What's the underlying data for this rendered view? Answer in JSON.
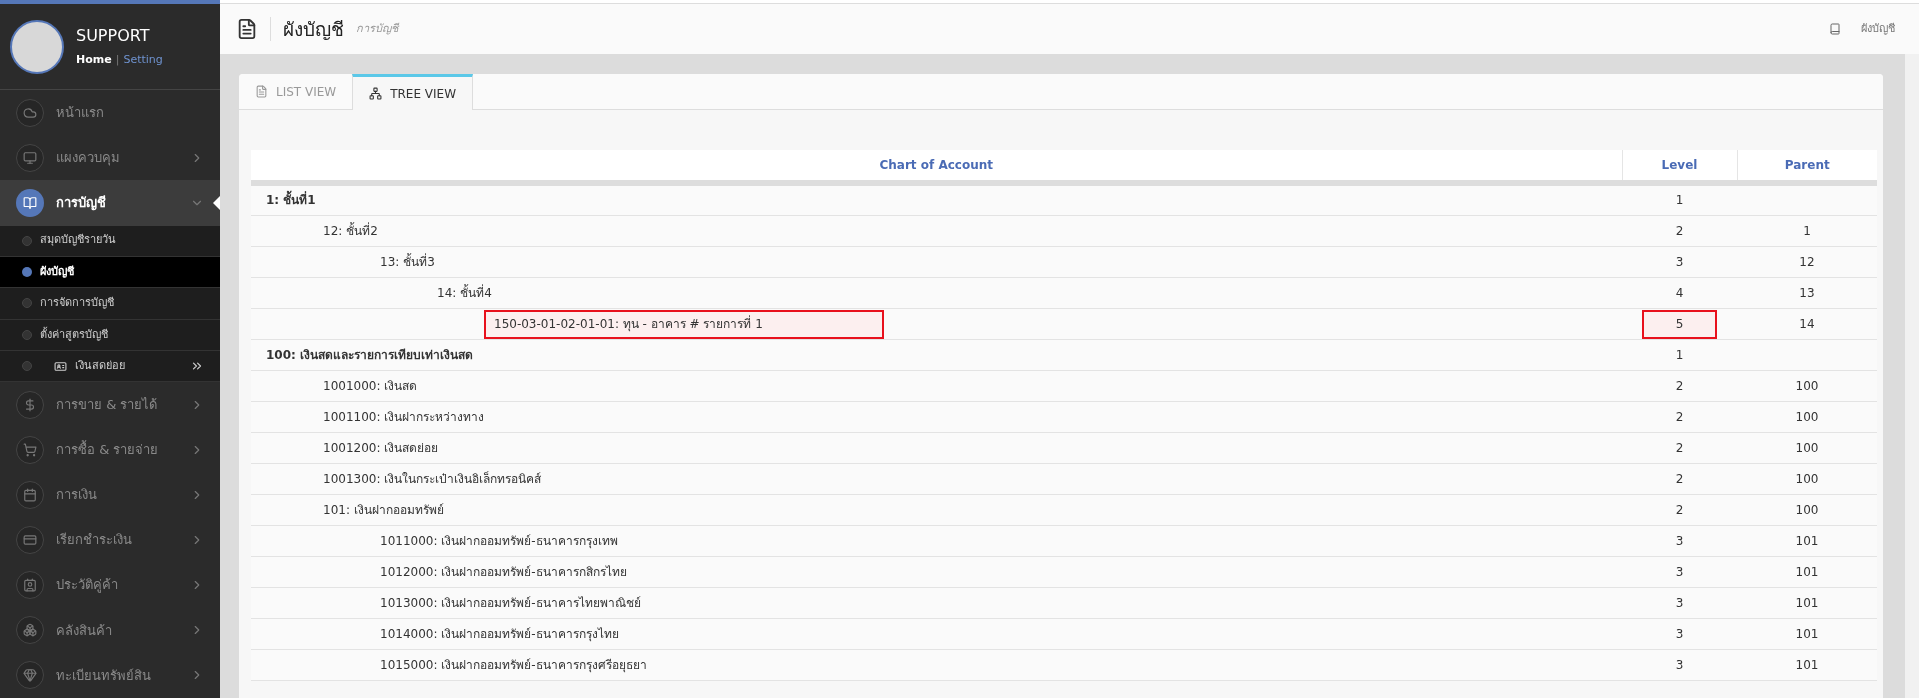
{
  "sidebar": {
    "user": "SUPPORT",
    "separator": "|",
    "links": [
      {
        "label": "Home",
        "selected": true
      },
      {
        "label": "Setting",
        "selected": false
      }
    ],
    "menu": [
      {
        "label": "หน้าแรก",
        "selected": false,
        "has_arrow": false
      },
      {
        "label": "แผงควบคุม",
        "selected": false,
        "has_arrow": true
      },
      {
        "label": "การบัญชี",
        "selected": true,
        "has_arrow": true,
        "expanded": true,
        "children": [
          {
            "label": "สมุดบัญชีรายวัน",
            "selected": false
          },
          {
            "label": "ผังบัญชี",
            "selected": true
          },
          {
            "label": "การจัดการบัญชี",
            "selected": false
          },
          {
            "label": "ตั้งค่าสูตรบัญชี",
            "selected": false
          },
          {
            "label": "เงินสดย่อย",
            "selected": false,
            "has_submenu": true
          }
        ]
      },
      {
        "label": "การขาย & รายได้",
        "selected": false,
        "has_arrow": true
      },
      {
        "label": "การซื้อ & รายจ่าย",
        "selected": false,
        "has_arrow": true
      },
      {
        "label": "การเงิน",
        "selected": false,
        "has_arrow": true
      },
      {
        "label": "เรียกชำระเงิน",
        "selected": false,
        "has_arrow": true
      },
      {
        "label": "ประวัติคู่ค้า",
        "selected": false,
        "has_arrow": true
      },
      {
        "label": "คลังสินค้า",
        "selected": false,
        "has_arrow": true
      },
      {
        "label": "ทะเบียนทรัพย์สิน",
        "selected": false,
        "has_arrow": true
      }
    ]
  },
  "page_header": {
    "title": "ผังบัญชี",
    "subtitle": "การบัญชี",
    "breadcrumb": "ผังบัญชี"
  },
  "tabs": [
    {
      "label": "LIST VIEW",
      "selected": false
    },
    {
      "label": "TREE VIEW",
      "selected": true
    }
  ],
  "table": {
    "columns": [
      "Chart of Account",
      "Level",
      "Parent"
    ],
    "rows": [
      {
        "account": "1: ชั้นที่1",
        "level": "1",
        "parent": "",
        "highlighted": false,
        "children": [
          {
            "account": "12: ชั้นที่2",
            "level": "2",
            "parent": "1",
            "highlighted": false,
            "children": [
              {
                "account": "13: ชั้นที่3",
                "level": "3",
                "parent": "12",
                "highlighted": false,
                "children": [
                  {
                    "account": "14: ชั้นที่4",
                    "level": "4",
                    "parent": "13",
                    "highlighted": false,
                    "children": [
                      {
                        "account": "150-03-01-02-01-01: ทุน - อาคาร # รายการที่ 1",
                        "level": "5",
                        "parent": "14",
                        "highlighted": true
                      }
                    ]
                  }
                ]
              }
            ]
          }
        ]
      },
      {
        "account": "100: เงินสดและรายการเทียบเท่าเงินสด",
        "level": "1",
        "parent": "",
        "highlighted": false,
        "children": [
          {
            "account": "1001000: เงินสด",
            "level": "2",
            "parent": "100",
            "highlighted": false
          },
          {
            "account": "1001100: เงินฝากระหว่างทาง",
            "level": "2",
            "parent": "100",
            "highlighted": false
          },
          {
            "account": "1001200: เงินสดย่อย",
            "level": "2",
            "parent": "100",
            "highlighted": false
          },
          {
            "account": "1001300: เงินในกระเป๋าเงินอิเล็กทรอนิคส์",
            "level": "2",
            "parent": "100",
            "highlighted": false
          },
          {
            "account": "101: เงินฝากออมทรัพย์",
            "level": "2",
            "parent": "100",
            "highlighted": false,
            "children": [
              {
                "account": "1011000: เงินฝากออมทรัพย์-ธนาคารกรุงเทพ",
                "level": "3",
                "parent": "101",
                "highlighted": false
              },
              {
                "account": "1012000: เงินฝากออมทรัพย์-ธนาคารกสิกรไทย",
                "level": "3",
                "parent": "101",
                "highlighted": false
              },
              {
                "account": "1013000: เงินฝากออมทรัพย์-ธนาคารไทยพาณิชย์",
                "level": "3",
                "parent": "101",
                "highlighted": false
              },
              {
                "account": "1014000: เงินฝากออมทรัพย์-ธนาคารกรุงไทย",
                "level": "3",
                "parent": "101",
                "highlighted": false
              },
              {
                "account": "1015000: เงินฝากออมทรัพย์-ธนาคารกรุงศรีอยุธยา",
                "level": "3",
                "parent": "101",
                "highlighted": false
              }
            ]
          }
        ]
      }
    ]
  }
}
